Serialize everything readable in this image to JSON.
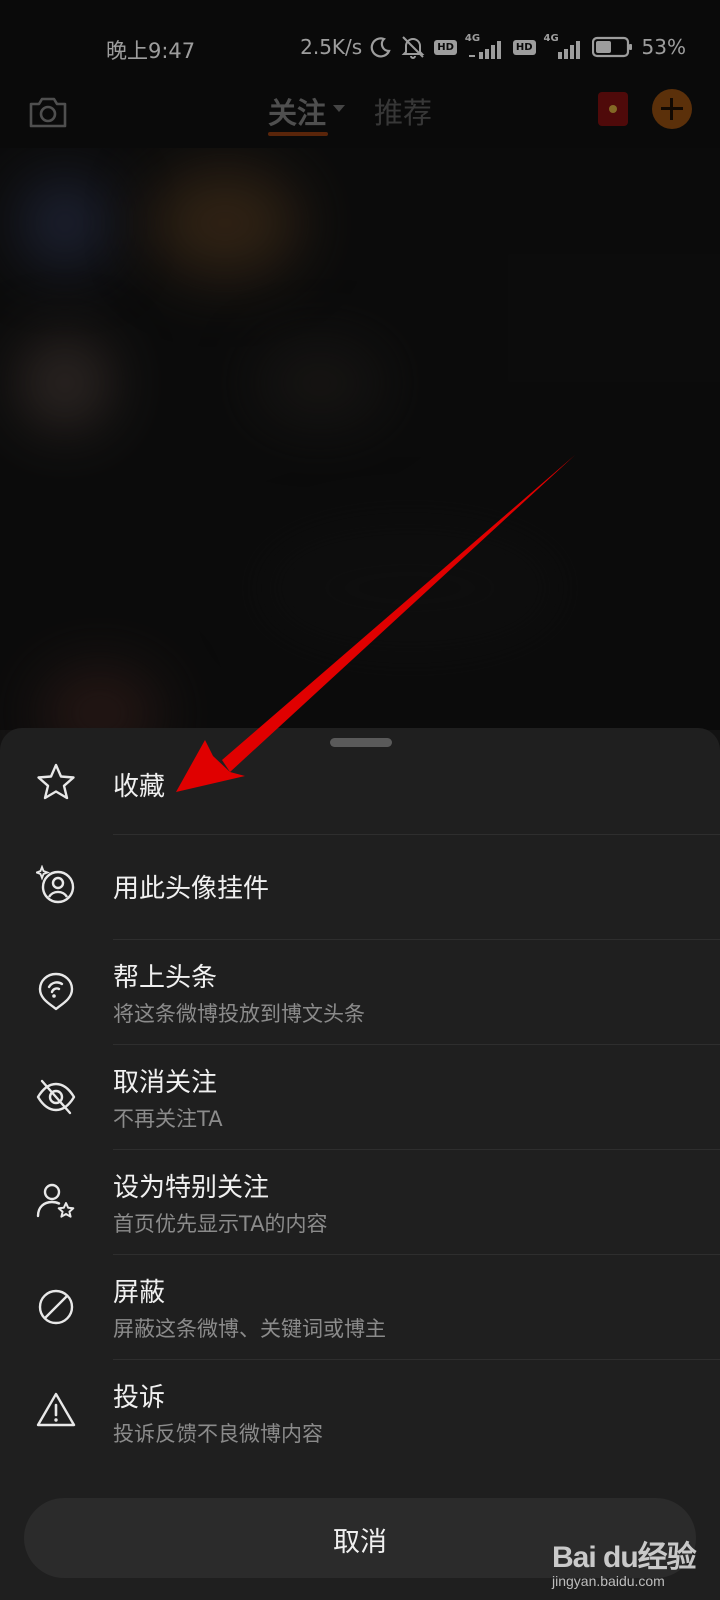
{
  "status_bar": {
    "time": "晚上9:47",
    "net_speed": "2.5K/s",
    "hd_label": "HD",
    "network_label": "4G",
    "battery_pct": "53%",
    "battery_level": 0.53,
    "icons": [
      "moon-icon",
      "mute-bell-icon",
      "signal-icon",
      "battery-icon"
    ]
  },
  "nav": {
    "tabs": [
      {
        "label": "关注",
        "active": true
      },
      {
        "label": "推荐",
        "active": false
      }
    ],
    "icons": [
      "camera-icon",
      "red-packet-icon",
      "add-icon"
    ],
    "accent_color": "#e8650f"
  },
  "sheet": {
    "items": [
      {
        "title": "收藏",
        "subtitle": "",
        "icon": "star-icon"
      },
      {
        "title": "用此头像挂件",
        "subtitle": "",
        "icon": "avatar-pendant-icon"
      },
      {
        "title": "帮上头条",
        "subtitle": "将这条微博投放到博文头条",
        "icon": "headline-icon"
      },
      {
        "title": "取消关注",
        "subtitle": "不再关注TA",
        "icon": "eye-off-icon"
      },
      {
        "title": "设为特别关注",
        "subtitle": "首页优先显示TA的内容",
        "icon": "user-star-icon"
      },
      {
        "title": "屏蔽",
        "subtitle": "屏蔽这条微博、关键词或博主",
        "icon": "block-icon"
      },
      {
        "title": "投诉",
        "subtitle": "投诉反馈不良微博内容",
        "icon": "warning-icon"
      }
    ],
    "cancel_label": "取消"
  },
  "watermark": {
    "brand": "Bai du经验",
    "url": "jingyan.baidu.com"
  },
  "colors": {
    "sheet_bg": "#1f1f1f",
    "annotation_arrow": "#e00000"
  }
}
